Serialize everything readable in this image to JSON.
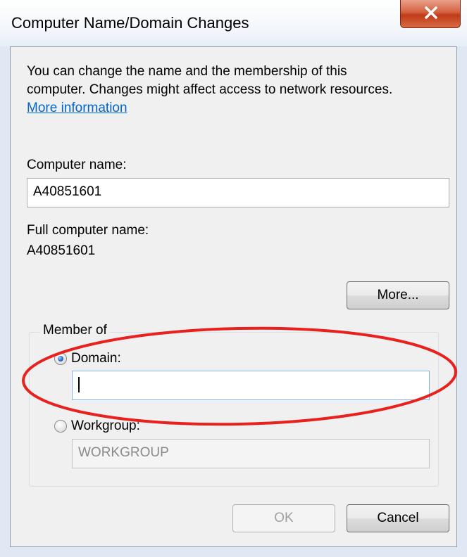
{
  "window": {
    "title": "Computer Name/Domain Changes"
  },
  "intro": {
    "line1": "You can change the name and the membership of this",
    "line2": "computer. Changes might affect access to network resources.",
    "more_info_link": "More information"
  },
  "computer_name": {
    "label": "Computer name:",
    "value": "A40851601"
  },
  "full_computer_name": {
    "label": "Full computer name:",
    "value": "A40851601"
  },
  "more_button": "More...",
  "member_of": {
    "label": "Member of",
    "domain": {
      "label": "Domain:",
      "selected": true,
      "value": ""
    },
    "workgroup": {
      "label": "Workgroup:",
      "selected": false,
      "value": "WORKGROUP"
    }
  },
  "buttons": {
    "ok": "OK",
    "cancel": "Cancel"
  },
  "annotation": {
    "color": "#e8201e"
  }
}
